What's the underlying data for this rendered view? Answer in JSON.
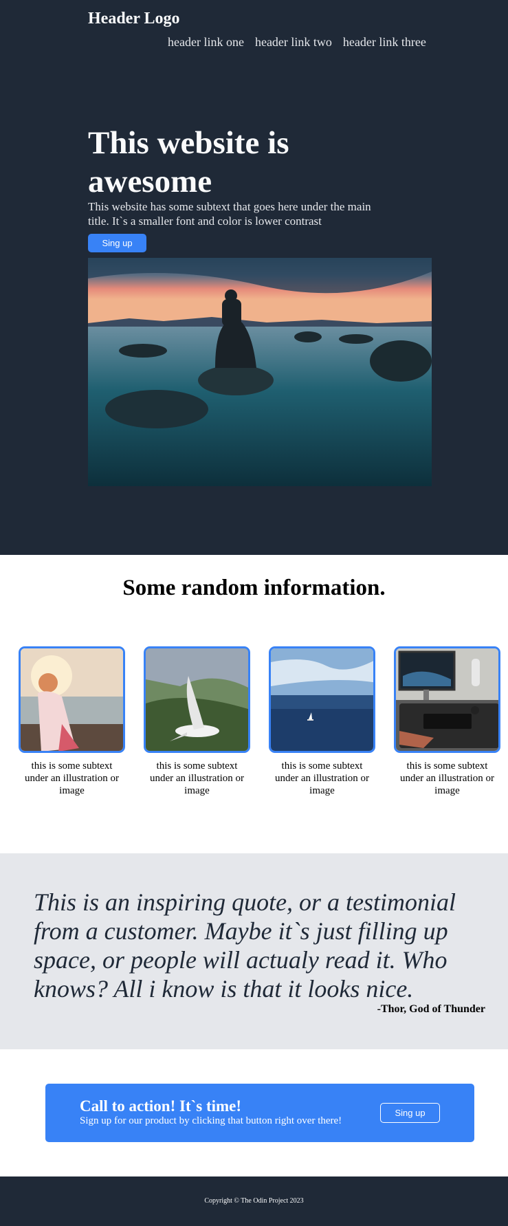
{
  "header": {
    "logo": "Header Logo",
    "links": [
      "header link one",
      "header link two",
      "header link three"
    ]
  },
  "hero": {
    "title": "This website is awesome",
    "subtext": "This website has some subtext that goes here under the main title. It`s a smaller font and color is lower contrast",
    "button_label": "Sing up",
    "image": "person-sitting-on-rock-at-sunset-image"
  },
  "info": {
    "title": "Some random information.",
    "cards": [
      {
        "text": "this is some subtext under an illustration or image",
        "image": "woman-at-beach-image"
      },
      {
        "text": "this is some subtext under an illustration or image",
        "image": "seagull-flying-image"
      },
      {
        "text": "this is some subtext under an illustration or image",
        "image": "boat-on-ocean-image"
      },
      {
        "text": "this is some subtext under an illustration or image",
        "image": "desk-setup-image"
      }
    ]
  },
  "quote": {
    "text": "This is an inspiring quote, or a testimonial from a customer. Maybe it`s just filling up space, or people will actualy read it. Who knows? All i know is that it looks nice.",
    "author": "-Thor, God of Thunder"
  },
  "cta": {
    "title": "Call to action! It`s time!",
    "subtext": "Sign up for our product by clicking that button right over there!",
    "button_label": "Sing up"
  },
  "footer": {
    "text": "Copyright © The Odin Project 2023"
  },
  "colors": {
    "dark": "#1f2937",
    "accent": "#3882f6",
    "light_gray": "#e5e7eb"
  }
}
